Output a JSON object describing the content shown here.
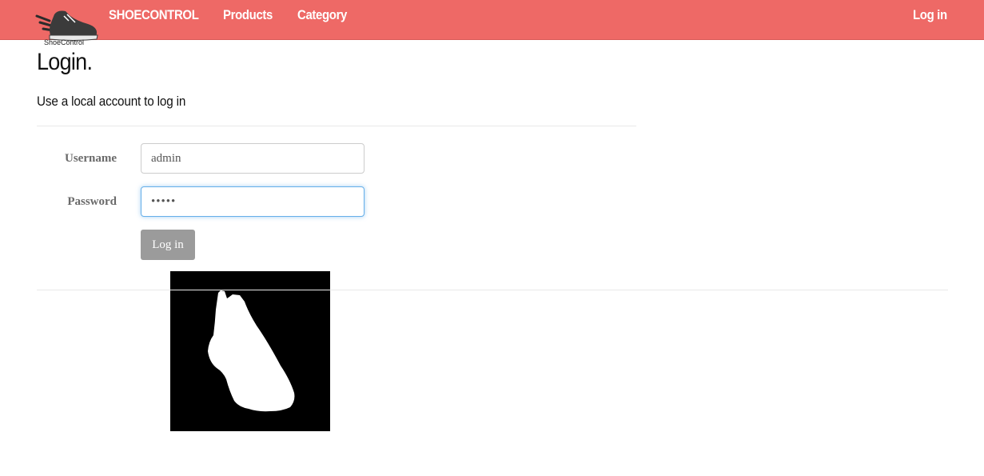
{
  "navbar": {
    "logo_text": "ShoeControl",
    "brand": "SHOECONTROL",
    "links": [
      {
        "label": "Products"
      },
      {
        "label": "Category"
      }
    ],
    "login_label": "Log in",
    "background_color": "#ee6966"
  },
  "main": {
    "title": "Login.",
    "subtitle": "Use a local account to log in",
    "form": {
      "username_label": "Username",
      "username_value": "admin",
      "password_label": "Password",
      "password_value": "•••••",
      "submit_label": "Log in"
    }
  },
  "icons": {
    "logo": "shoe-logo-icon",
    "preview": "shoe-silhouette-mask"
  }
}
